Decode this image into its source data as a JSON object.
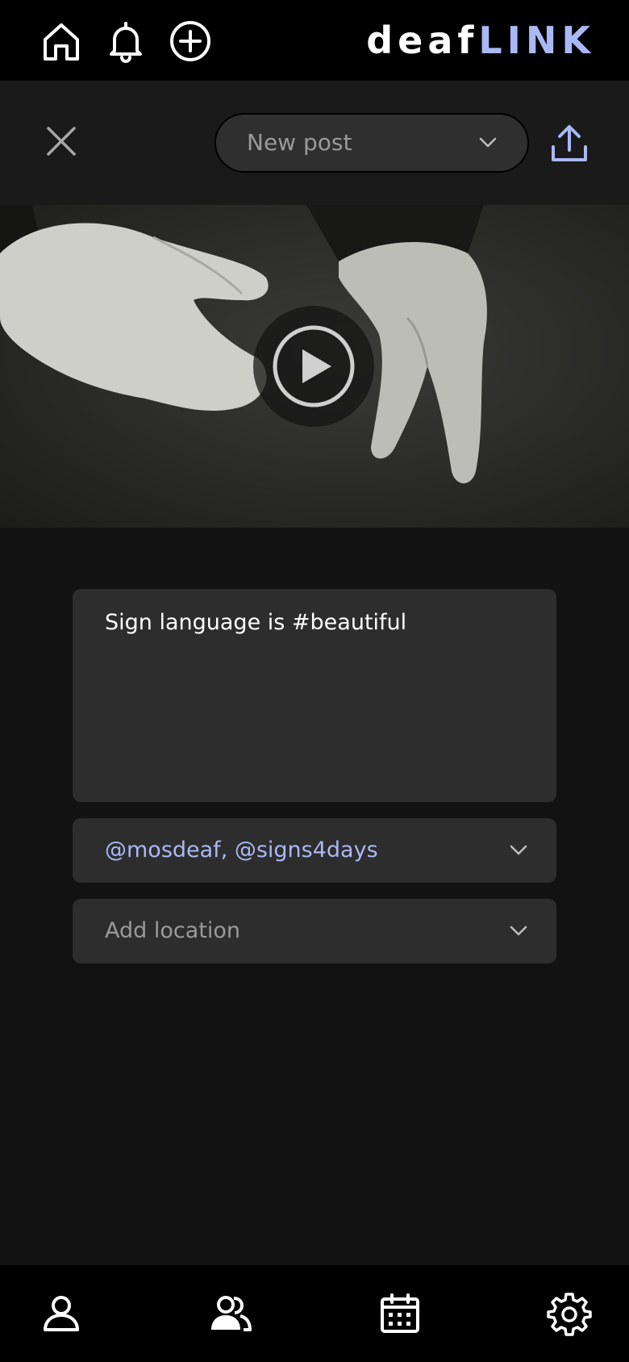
{
  "header": {
    "brand_part1": "deaf",
    "brand_part2": "LINK",
    "icons": [
      "home-icon",
      "bell-icon",
      "add-circle-icon"
    ]
  },
  "actions": {
    "close_icon": "close-icon",
    "post_type": "New post",
    "upload_icon": "upload-icon"
  },
  "media": {
    "play_icon": "play-icon"
  },
  "form": {
    "caption": "Sign language is #beautiful",
    "tags": "@mosdeaf, @signs4days",
    "location_placeholder": "Add location"
  },
  "bottom_nav": {
    "icons": [
      "profile-icon",
      "people-icon",
      "calendar-icon",
      "settings-icon"
    ]
  },
  "colors": {
    "accent": "#aab8f5",
    "background": "#121212",
    "bar": "#000000",
    "field": "#2d2d2d"
  }
}
